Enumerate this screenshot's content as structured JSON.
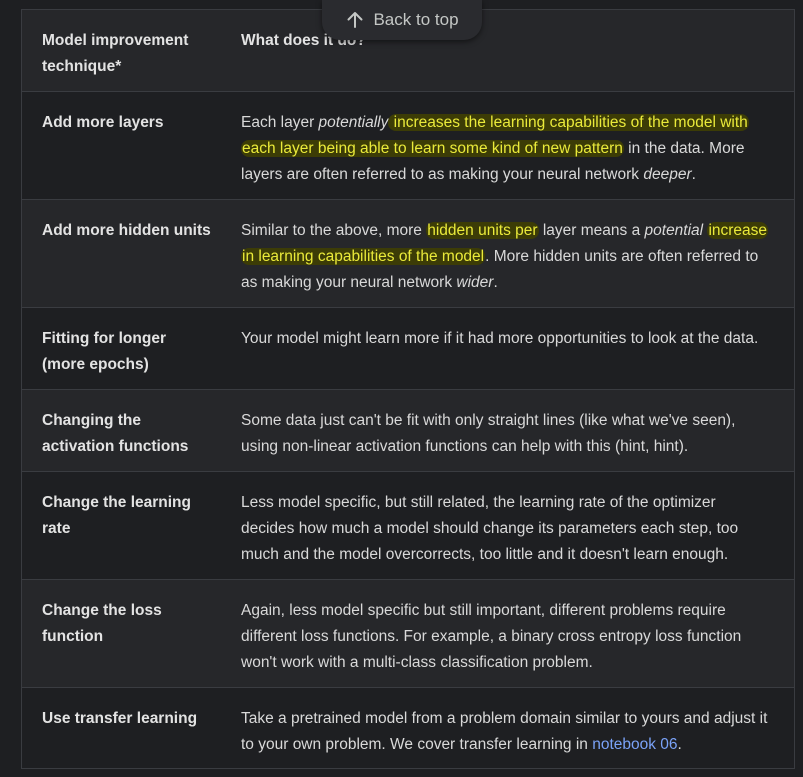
{
  "back_to_top": {
    "label": "Back to top",
    "icon": "arrow-up-icon"
  },
  "table": {
    "headers": {
      "technique": "Model improvement technique*",
      "description": "What does it do?"
    },
    "rows": [
      {
        "technique": "Add more layers",
        "segments": [
          {
            "t": "Each layer "
          },
          {
            "t": "potentially",
            "i": true
          },
          {
            "t": " increases the learning capabilities of the model with each layer being able to learn some kind of new pattern",
            "hl": true
          },
          {
            "t": " in the data. More layers are often referred to as making your neural network "
          },
          {
            "t": "deeper",
            "i": true
          },
          {
            "t": "."
          }
        ]
      },
      {
        "technique": "Add more hidden units",
        "segments": [
          {
            "t": "Similar to the above, more "
          },
          {
            "t": "hidden units per",
            "hl": true
          },
          {
            "t": " layer means a "
          },
          {
            "t": "potential",
            "i": true
          },
          {
            "t": " "
          },
          {
            "t": "increase in learning capabilities of the model",
            "hl": true
          },
          {
            "t": ". More hidden units are often referred to as making your neural network "
          },
          {
            "t": "wider",
            "i": true
          },
          {
            "t": "."
          }
        ]
      },
      {
        "technique": "Fitting for longer (more epochs)",
        "segments": [
          {
            "t": "Your model might learn more if it had more opportunities to look at the data."
          }
        ]
      },
      {
        "technique": "Changing the activation functions",
        "segments": [
          {
            "t": "Some data just can't be fit with only straight lines (like what we've seen), using non-linear activation functions can help with this (hint, hint)."
          }
        ]
      },
      {
        "technique": "Change the learning rate",
        "segments": [
          {
            "t": "Less model specific, but still related, the learning rate of the optimizer decides how much a model should change its parameters each step, too much and the model overcorrects, too little and it doesn't learn enough."
          }
        ]
      },
      {
        "technique": "Change the loss function",
        "segments": [
          {
            "t": "Again, less model specific but still important, different problems require different loss functions. For example, a binary cross entropy loss function won't work with a multi-class classification problem."
          }
        ]
      },
      {
        "technique": "Use transfer learning",
        "segments": [
          {
            "t": "Take a pretrained model from a problem domain similar to yours and adjust it to your own problem. We cover transfer learning in "
          },
          {
            "t": "notebook 06",
            "link": true
          },
          {
            "t": "."
          }
        ]
      }
    ]
  },
  "colors": {
    "background": "#1e1f22",
    "row_stripe": "#26272a",
    "border": "#3a3c41",
    "highlight_text": "#eaea3a",
    "highlight_bg": "#3c3c06",
    "link": "#7aa2f7"
  }
}
